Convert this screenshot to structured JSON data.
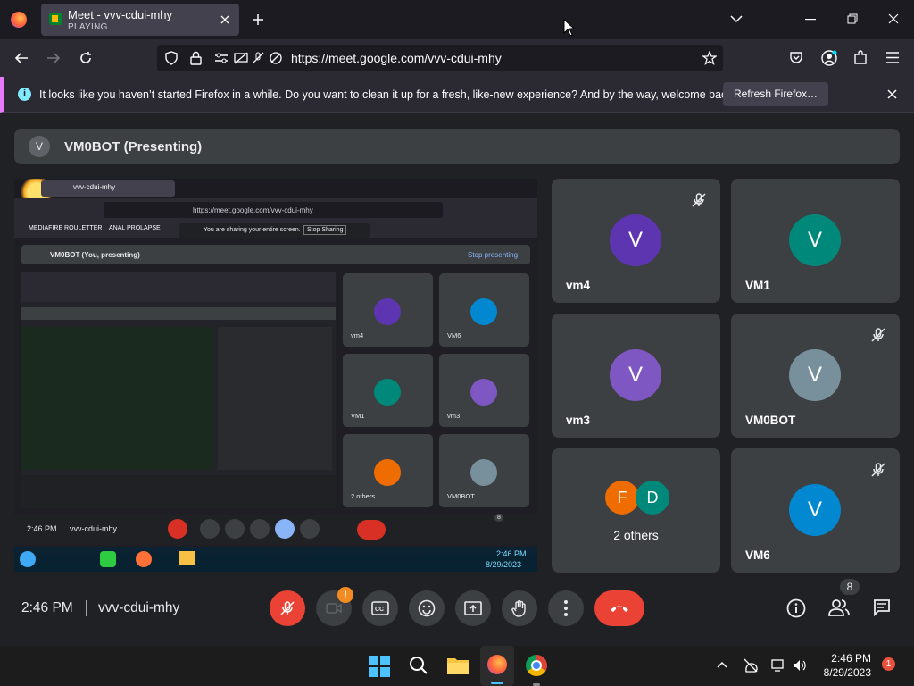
{
  "browser": {
    "tab_title": "Meet - vvv-cdui-mhy",
    "tab_status": "PLAYING",
    "url": "https://meet.google.com/vvv-cdui-mhy",
    "notice": "It looks like you haven’t started Firefox in a while. Do you want to clean it up for a fresh, like-new experience? And by the way, welcome back!",
    "refresh_label": "Refresh Firefox…"
  },
  "meet": {
    "presenter_initial": "V",
    "presenter_label": "VM0BOT (Presenting)",
    "tiles": [
      {
        "initial": "V",
        "name": "vm4",
        "color": "#5e35b1",
        "muted": true
      },
      {
        "initial": "V",
        "name": "VM1",
        "color": "#00897b",
        "muted": false
      },
      {
        "initial": "V",
        "name": "vm3",
        "color": "#7e57c2",
        "muted": false
      },
      {
        "initial": "V",
        "name": "VM0BOT",
        "color": "#78909c",
        "muted": true
      },
      {
        "initial": "F",
        "initial2": "D",
        "name": "2 others",
        "color": "#ef6c00",
        "color2": "#00897b",
        "muted": false
      },
      {
        "initial": "V",
        "name": "VM6",
        "color": "#0288d1",
        "muted": true
      }
    ],
    "time": "2:46 PM",
    "meeting_code": "vvv-cdui-mhy",
    "participant_count": "8",
    "camera_alert": "!"
  },
  "shared_screen": {
    "url": "https://meet.google.com/vvv-cdui-mhy",
    "bookmark1": "MEDIAFIRE ROULETTER",
    "bookmark2": "ANAL PROLAPSE",
    "sharing_msg": "You are sharing your entire screen.",
    "stop_sharing": "Stop Sharing",
    "presenting_label": "VM0BOT (You, presenting)",
    "stop_presenting": "Stop presenting",
    "tile_names": [
      "vm4",
      "VM6",
      "VM1",
      "vm3",
      "2 others",
      "VM0BOT"
    ],
    "time": "2:46 PM",
    "code": "vvv-cdui-mhy",
    "count": "8",
    "tb_time": "2:46 PM",
    "tb_date": "8/29/2023"
  },
  "taskbar": {
    "time": "2:46 PM",
    "date": "8/29/2023",
    "notification_count": "1"
  }
}
